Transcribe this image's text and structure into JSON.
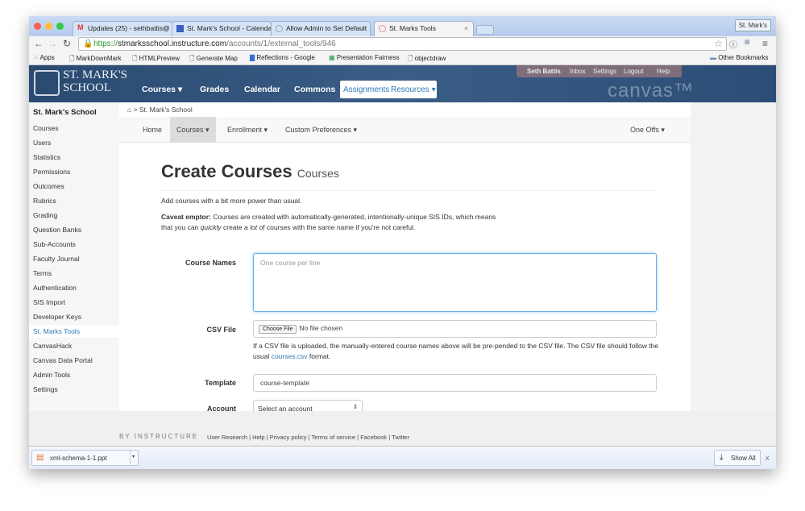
{
  "browser": {
    "tabs": [
      {
        "label": "Updates (25) - sethbattis@",
        "icon": "gmail-icon"
      },
      {
        "label": "St. Mark's School - Calendar",
        "icon": "calendar-icon"
      },
      {
        "label": "Allow Admin to Set Default",
        "icon": "loading-icon"
      },
      {
        "label": "St. Marks Tools",
        "icon": "loading-icon",
        "active": true
      }
    ],
    "profile": "St. Mark's",
    "url_scheme": "https://",
    "url_host": "stmarksschool.instructure.com",
    "url_path": "/accounts/1/external_tools/946",
    "bookmarks": [
      "Apps",
      "MarkDownMark",
      "HTMLPreview",
      "Generate Map",
      "Reflections - Google",
      "Presentation Fairness",
      "objectdraw"
    ],
    "other_bookmarks": "Other Bookmarks"
  },
  "header": {
    "logo_line1": "ST. MARK'S",
    "logo_line2": "SCHOOL",
    "nav": [
      "Courses ▾",
      "Grades",
      "Calendar",
      "Commons"
    ],
    "white_links": [
      "Assignments",
      "Resources ▾"
    ],
    "user_menu": [
      "Seth Battis",
      "Inbox",
      "Settings",
      "Logout",
      "Help"
    ],
    "canvas_logo": "canvas™"
  },
  "sidebar": {
    "title": "St. Mark's School",
    "items": [
      "Courses",
      "Users",
      "Statistics",
      "Permissions",
      "Outcomes",
      "Rubrics",
      "Grading",
      "Question Banks",
      "Sub-Accounts",
      "Faculty Journal",
      "Terms",
      "Authentication",
      "SIS Import",
      "Developer Keys",
      "St. Marks Tools",
      "CanvasHack",
      "Canvas Data Portal",
      "Admin Tools",
      "Settings"
    ],
    "active": "St. Marks Tools"
  },
  "breadcrumb": {
    "home_icon": "home-icon",
    "sep": ">",
    "item": "St. Mark's School"
  },
  "subnav": {
    "items": [
      "Home",
      "Courses ▾",
      "Enrollment ▾",
      "Custom Preferences ▾"
    ],
    "right": "One Offs ▾",
    "active": "Courses ▾"
  },
  "page": {
    "title": "Create Courses",
    "subtitle": "Courses",
    "intro": "Add courses with a bit more power than usual.",
    "caveat_bold": "Caveat emptor:",
    "caveat_1": " Courses are created with automatically-generated, intentionally-unique SIS IDs, which means that you can ",
    "caveat_em1": "quickly",
    "caveat_2": " create ",
    "caveat_em2": "a lot",
    "caveat_3": " of courses with the same name if you're not careful.",
    "course_names_label": "Course Names",
    "course_names_placeholder": "One course per line",
    "csv_label": "CSV File",
    "choose_file": "Choose File",
    "no_file": "No file chosen",
    "csv_help_1": "If a CSV file is uploaded, the manually-entered course names above will be pre-pended to the CSV file. The CSV file should follow the usual ",
    "csv_help_link": "courses.csv",
    "csv_help_2": " format.",
    "template_label": "Template",
    "template_value": "course-template",
    "account_label": "Account",
    "account_value": "Select an account"
  },
  "footer": {
    "by": "BY INSTRUCTURE",
    "links": "User Research | Help | Privacy policy | Terms of service | Facebook | Twitter"
  },
  "downloads": {
    "file": "xml-schema-1-1.ppt",
    "show_all": "Show All",
    "close": "x"
  }
}
